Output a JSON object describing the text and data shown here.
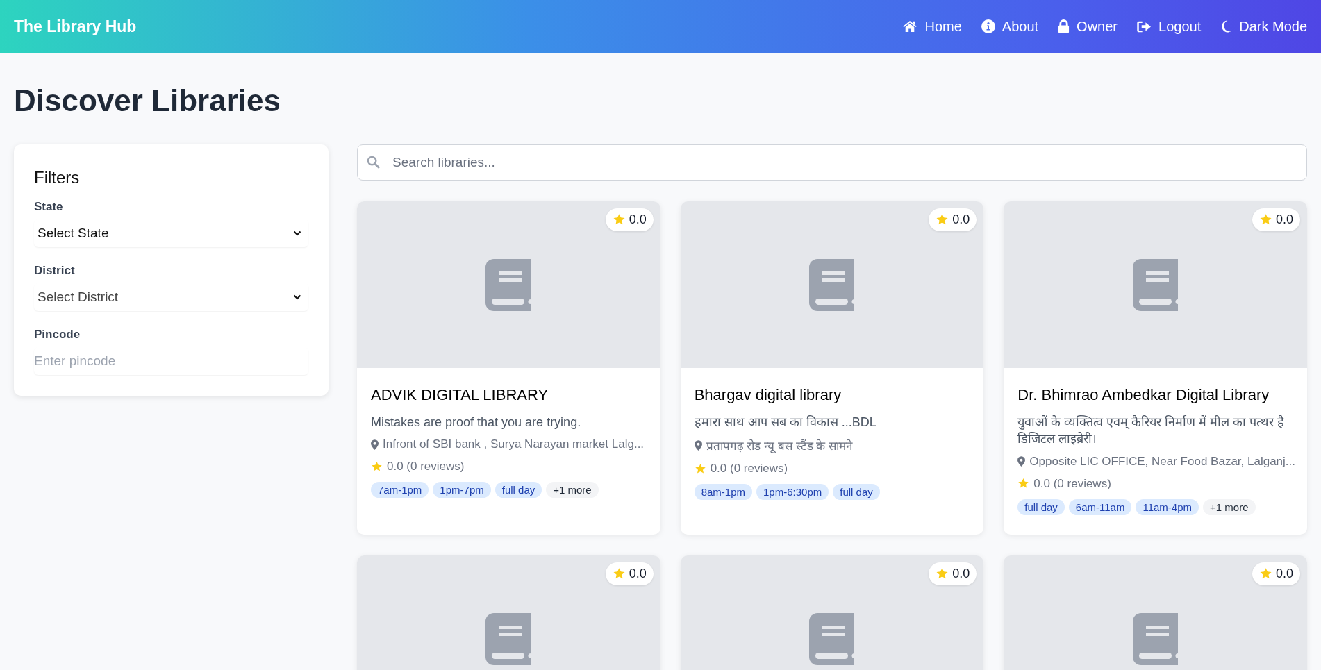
{
  "navbar": {
    "brand": "The Library Hub",
    "links": [
      {
        "kind": "home",
        "label": "Home"
      },
      {
        "kind": "info",
        "label": "About"
      },
      {
        "kind": "lock",
        "label": "Owner"
      },
      {
        "kind": "logout",
        "label": "Logout"
      },
      {
        "kind": "moon",
        "label": "Dark Mode"
      }
    ]
  },
  "page_title": "Discover Libraries",
  "filters": {
    "title": "Filters",
    "fields": [
      {
        "kind": "select",
        "label": "State",
        "value": "Select State"
      },
      {
        "kind": "select",
        "label": "District",
        "value": "Select District"
      },
      {
        "kind": "input",
        "label": "Pincode",
        "placeholder": "Enter pincode"
      }
    ]
  },
  "search": {
    "placeholder": "Search libraries..."
  },
  "cards": [
    {
      "rating_badge": "0.0",
      "name": "ADVIK DIGITAL LIBRARY",
      "tagline": "Mistakes are proof that you are trying.",
      "address": "Infront of SBI bank , Surya Narayan market Lalg...",
      "rating": "0.0 (0 reviews)",
      "tags": [
        "7am-1pm",
        "1pm-7pm",
        "full day"
      ],
      "more": "+1 more"
    },
    {
      "rating_badge": "0.0",
      "name": "Bhargav digital library",
      "tagline": "हमारा साथ आप सब का विकास ...BDL",
      "address": "प्रतापगढ़ रोड न्यू बस स्टैंड के सामने",
      "rating": "0.0 (0 reviews)",
      "tags": [
        "8am-1pm",
        "1pm-6:30pm",
        "full day"
      ]
    },
    {
      "rating_badge": "0.0",
      "name": "Dr. Bhimrao Ambedkar Digital Library",
      "tagline": "युवाओं के व्यक्तित्व एवम् कैरियर निर्माण में मील का पत्थर है डिजिटल लाइब्रेरी।",
      "address": "Opposite LIC OFFICE, Near Food Bazar, Lalganj...",
      "rating": "0.0 (0 reviews)",
      "tags": [
        "full day",
        "6am-11am",
        "11am-4pm"
      ],
      "more": "+1 more"
    },
    {
      "rating_badge": "0.0"
    },
    {
      "rating_badge": "0.0"
    },
    {
      "rating_badge": "0.0"
    }
  ]
}
